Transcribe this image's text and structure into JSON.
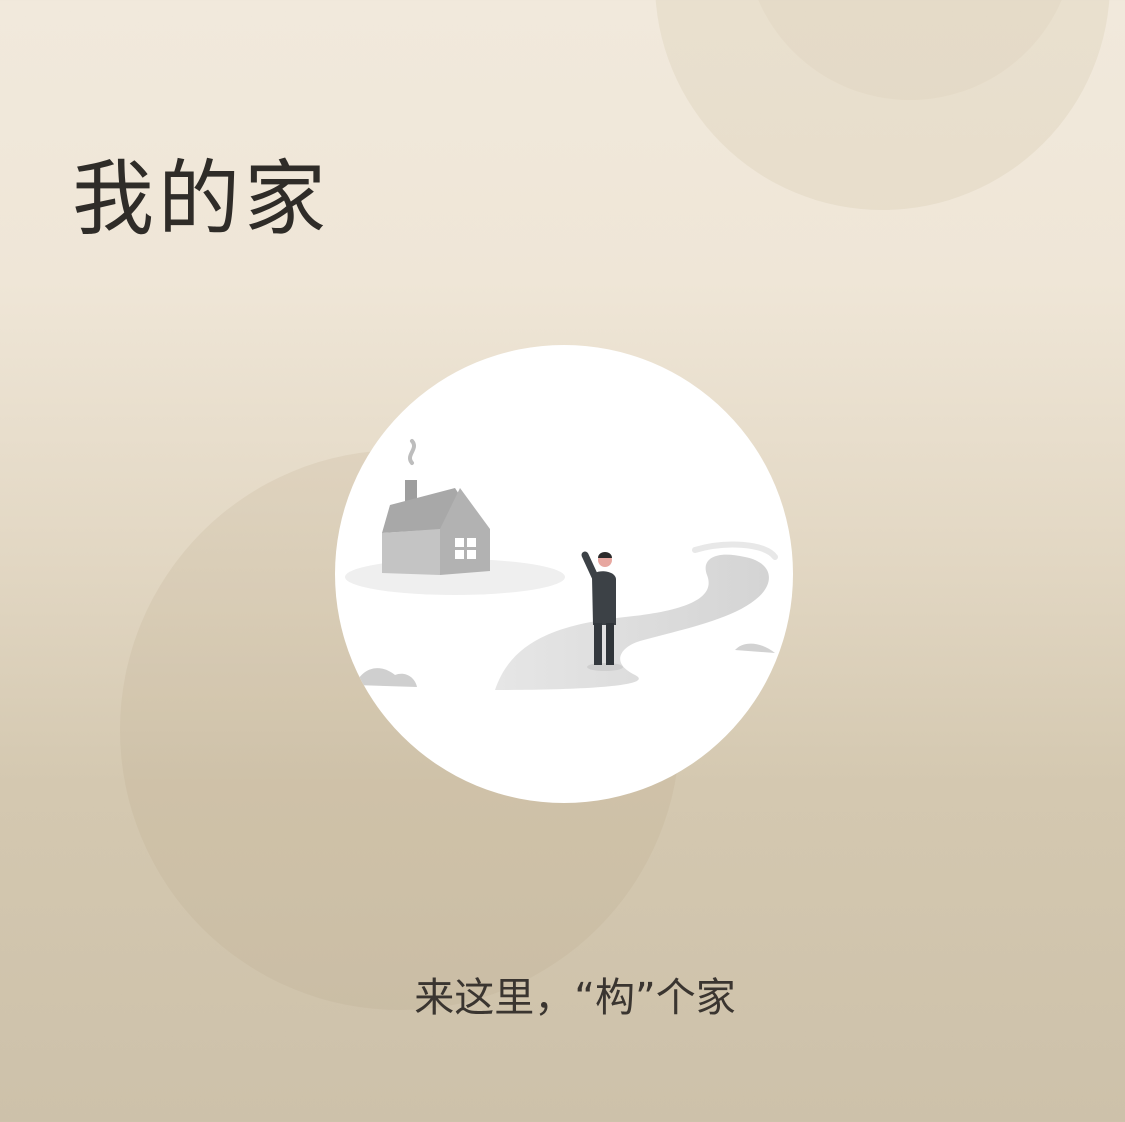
{
  "page": {
    "title": "我的家",
    "tagline": "来这里，“构”个家"
  },
  "illustration": {
    "icons": [
      "house-icon",
      "person-waving-icon",
      "winding-path-icon",
      "rock-icon"
    ]
  },
  "colors": {
    "background_top": "#f1e9dc",
    "background_bottom": "#cdc1aa",
    "title_text": "#2f2c28",
    "tagline_text": "#3a3530",
    "illustration_bg": "#ffffff"
  }
}
